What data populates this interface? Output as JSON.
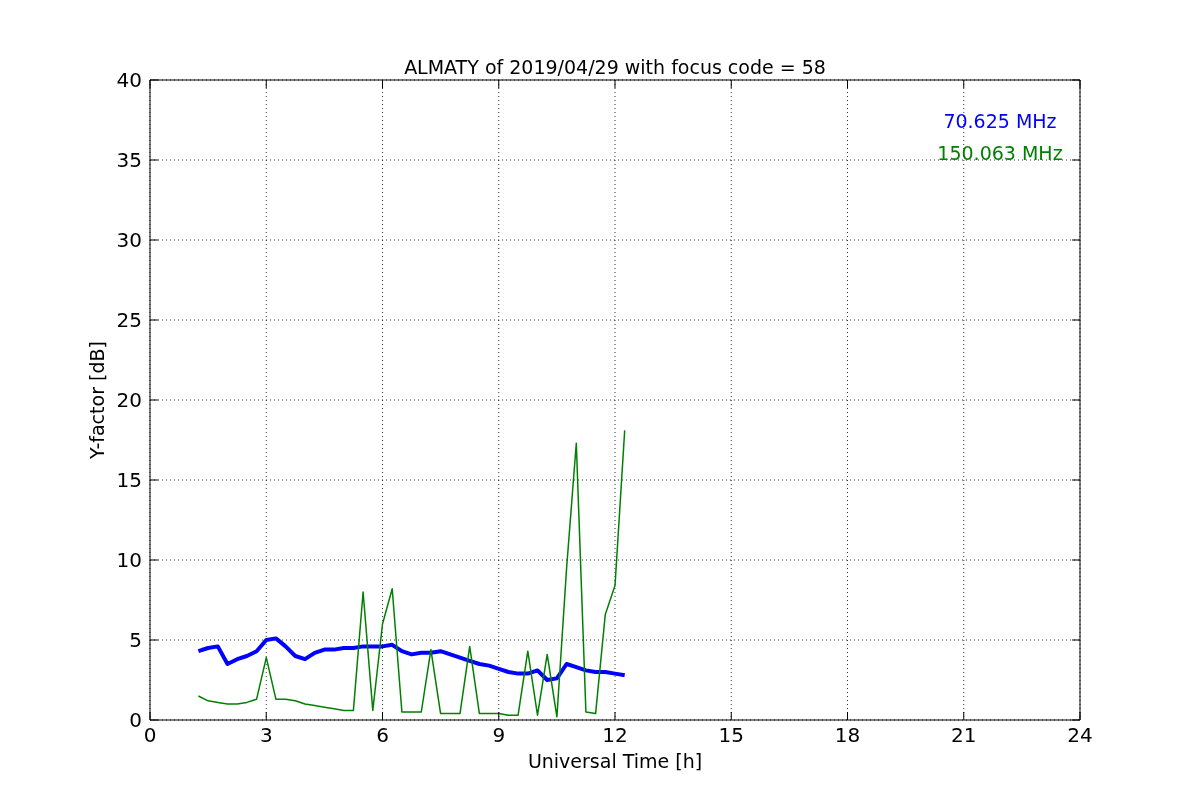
{
  "chart_data": {
    "type": "line",
    "title": "ALMATY of 2019/04/29 with focus code = 58",
    "xlabel": "Universal Time [h]",
    "ylabel": "Y-factor [dB]",
    "x": [
      1.25,
      1.5,
      1.75,
      2.0,
      2.25,
      2.5,
      2.75,
      3.0,
      3.25,
      3.5,
      3.75,
      4.0,
      4.25,
      4.5,
      4.75,
      5.0,
      5.25,
      5.5,
      5.75,
      6.0,
      6.25,
      6.5,
      6.75,
      7.0,
      7.25,
      7.5,
      7.75,
      8.0,
      8.25,
      8.5,
      8.75,
      9.0,
      9.25,
      9.5,
      9.75,
      10.0,
      10.25,
      10.5,
      10.75,
      11.0,
      11.25,
      11.5,
      11.75,
      12.0,
      12.25
    ],
    "series": [
      {
        "name": "70.625 MHz",
        "color": "#0000ff",
        "values": [
          4.3,
          4.5,
          4.6,
          3.5,
          3.8,
          4.0,
          4.3,
          5.0,
          5.1,
          4.6,
          4.0,
          3.8,
          4.2,
          4.4,
          4.4,
          4.5,
          4.5,
          4.6,
          4.6,
          4.6,
          4.7,
          4.3,
          4.1,
          4.2,
          4.2,
          4.3,
          4.1,
          3.9,
          3.7,
          3.5,
          3.4,
          3.2,
          3.0,
          2.9,
          2.9,
          3.1,
          2.5,
          2.6,
          3.5,
          3.3,
          3.1,
          3.0,
          3.0,
          2.9,
          2.8
        ]
      },
      {
        "name": "150.063 MHz",
        "color": "#008000",
        "values": [
          1.5,
          1.2,
          1.1,
          1.0,
          1.0,
          1.1,
          1.3,
          3.9,
          1.3,
          1.3,
          1.2,
          1.0,
          0.9,
          0.8,
          0.7,
          0.6,
          0.6,
          8.0,
          0.6,
          6.0,
          8.2,
          0.5,
          0.5,
          0.5,
          4.4,
          0.4,
          0.4,
          0.4,
          4.6,
          0.4,
          0.4,
          0.4,
          0.3,
          0.3,
          4.3,
          0.3,
          4.1,
          0.2,
          9.5,
          17.3,
          0.5,
          0.4,
          6.6,
          8.4,
          18.1
        ]
      }
    ],
    "xlim": [
      0,
      24
    ],
    "ylim": [
      0,
      40
    ],
    "xticks": [
      0,
      3,
      6,
      9,
      12,
      15,
      18,
      21,
      24
    ],
    "yticks": [
      0,
      5,
      10,
      15,
      20,
      25,
      30,
      35,
      40
    ],
    "grid": true
  }
}
